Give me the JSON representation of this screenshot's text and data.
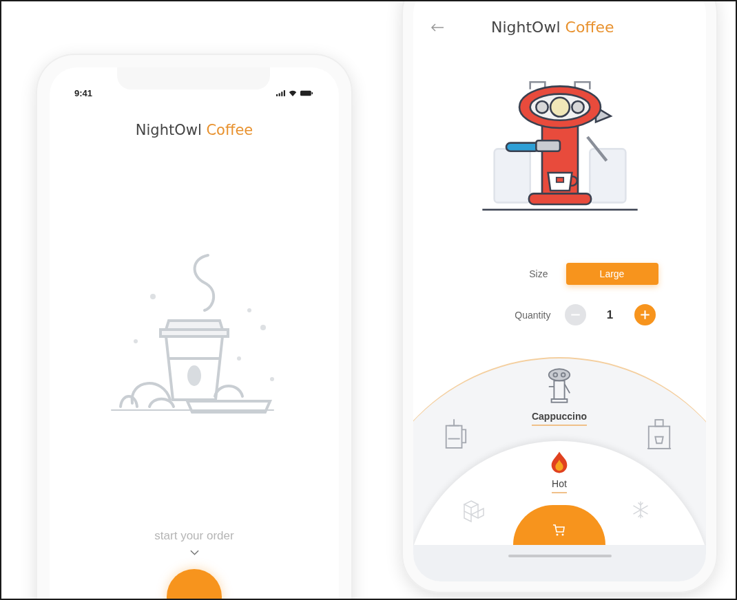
{
  "left_screen": {
    "status_bar": {
      "time": "9:41"
    },
    "title": {
      "brand": "NightOwl",
      "accent": "Coffee"
    },
    "prompt": "start your order"
  },
  "right_screen": {
    "title": {
      "brand": "NightOwl",
      "accent": "Coffee"
    },
    "size": {
      "label": "Size",
      "value": "Large"
    },
    "quantity": {
      "label": "Quantity",
      "value": "1"
    },
    "drinks": [
      {
        "kind": "press",
        "selected": false
      },
      {
        "kind": "espresso",
        "label": "Cappuccino",
        "selected": true
      },
      {
        "kind": "machine",
        "selected": false
      }
    ],
    "temperatures": [
      {
        "kind": "ice",
        "selected": false
      },
      {
        "kind": "hot",
        "label": "Hot",
        "selected": true
      },
      {
        "kind": "cold",
        "selected": false
      }
    ]
  }
}
